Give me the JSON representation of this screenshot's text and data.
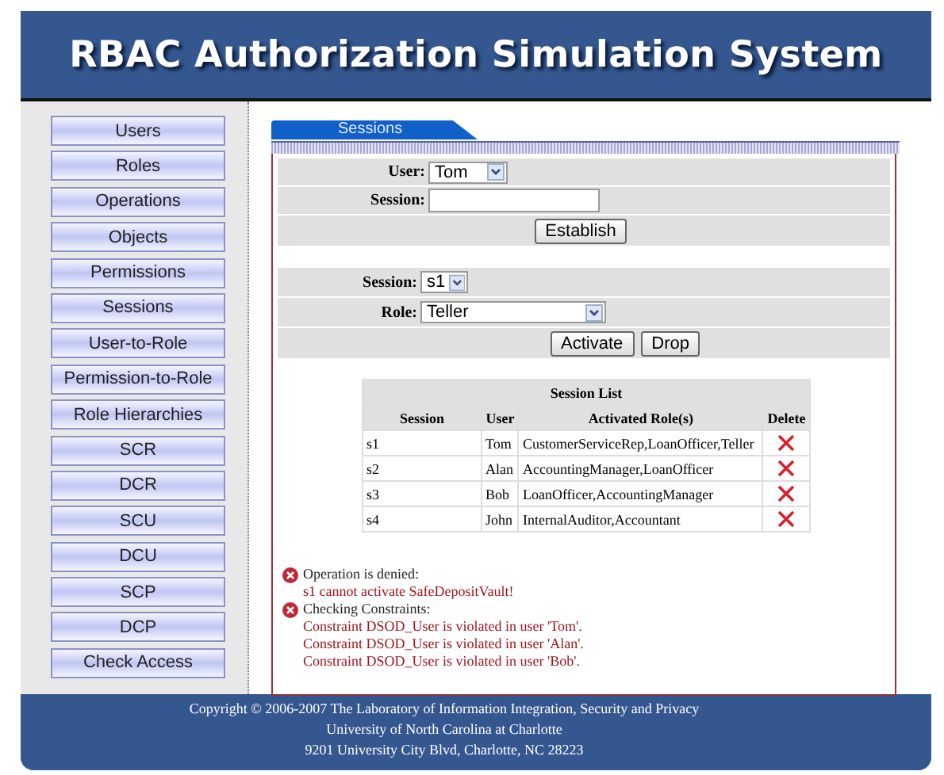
{
  "header": {
    "title": "RBAC Authorization Simulation System"
  },
  "nav": [
    {
      "label": "Users"
    },
    {
      "label": "Roles"
    },
    {
      "label": "Operations"
    },
    {
      "label": "Objects"
    },
    {
      "label": "Permissions"
    },
    {
      "label": "Sessions"
    },
    {
      "label": "User-to-Role"
    },
    {
      "label": "Permission-to-Role"
    },
    {
      "label": "Role Hierarchies"
    },
    {
      "label": "SCR"
    },
    {
      "label": "DCR"
    },
    {
      "label": "SCU"
    },
    {
      "label": "DCU"
    },
    {
      "label": "SCP"
    },
    {
      "label": "DCP"
    },
    {
      "label": "Check Access"
    }
  ],
  "tab": {
    "label": "Sessions"
  },
  "establish_form": {
    "user_label": "User:",
    "user_value": "Tom",
    "session_label": "Session:",
    "button": "Establish"
  },
  "activate_form": {
    "session_label": "Session:",
    "session_value": "s1",
    "role_label": "Role:",
    "role_value": "Teller",
    "buttons": [
      "Activate",
      "Drop"
    ]
  },
  "session_list": {
    "title": "Session List",
    "columns": [
      "Session",
      "User",
      "Activated Role(s)",
      "Delete"
    ],
    "rows": [
      {
        "session": "s1",
        "user": "Tom",
        "roles": "CustomerServiceRep,LoanOfficer,Teller"
      },
      {
        "session": "s2",
        "user": "Alan",
        "roles": "AccountingManager,LoanOfficer"
      },
      {
        "session": "s3",
        "user": "Bob",
        "roles": "LoanOfficer,AccountingManager"
      },
      {
        "session": "s4",
        "user": "John",
        "roles": "InternalAuditor,Accountant"
      }
    ]
  },
  "messages": [
    {
      "heading": "Operation is denied:",
      "lines": [
        "s1 cannot activate SafeDepositVault!"
      ]
    },
    {
      "heading": "Checking Constraints:",
      "lines": [
        "Constraint DSOD_User is violated in user 'Tom'.",
        "Constraint DSOD_User is violated in user 'Alan'.",
        "Constraint DSOD_User is violated in user 'Bob'."
      ]
    }
  ],
  "footer": {
    "lines": [
      "Copyright © 2006-2007 The Laboratory of Information Integration, Security and Privacy",
      "University of North Carolina at Charlotte",
      "9201 University City Blvd, Charlotte, NC 28223"
    ]
  }
}
